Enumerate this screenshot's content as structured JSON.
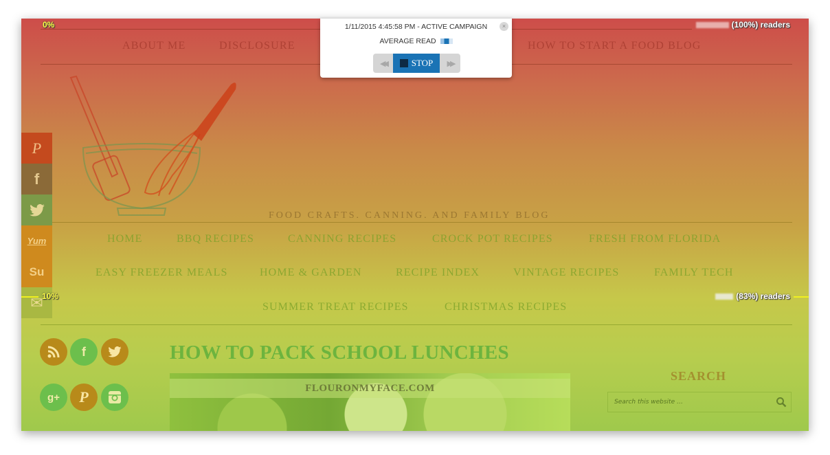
{
  "heatmap": {
    "top_marker": "0%",
    "top_readers": "(100%) readers",
    "mid_marker": "10%",
    "mid_readers": "(83%) readers"
  },
  "popup": {
    "title": "1/11/2015 4:45:58 PM - ACTIVE CAMPAIGN",
    "average_read_label": "AVERAGE READ",
    "stop_label": "STOP",
    "close_glyph": "×",
    "rewind_glyph": "◀◀",
    "forward_glyph": "▶▶"
  },
  "top_nav": [
    "ABOUT ME",
    "DISCLOSURE",
    "HOW TO START A FOOD BLOG"
  ],
  "tagline": "FOOD CRAFTS, CANNING, AND FAMILY BLOG",
  "share_bar": [
    {
      "icon": "pinterest-icon",
      "glyph": "P",
      "color": "#c44a1e"
    },
    {
      "icon": "facebook-icon",
      "glyph": "f",
      "color": "#8b6a38"
    },
    {
      "icon": "twitter-icon",
      "glyph": "t",
      "color": "#7c9a48"
    },
    {
      "icon": "yummly-icon",
      "glyph": "Yum",
      "color": "#cf8a1e"
    },
    {
      "icon": "stumbleupon-icon",
      "glyph": "Su",
      "color": "#cf8a1e"
    },
    {
      "icon": "email-icon",
      "glyph": "✉",
      "color": "#a9b842"
    }
  ],
  "main_nav": {
    "row1": [
      "HOME",
      "BBQ RECIPES",
      "CANNING RECIPES",
      "CROCK POT RECIPES",
      "FRESH FROM FLORIDA"
    ],
    "row2": [
      "EASY FREEZER MEALS",
      "HOME & GARDEN",
      "RECIPE INDEX",
      "VINTAGE RECIPES",
      "FAMILY TECH"
    ],
    "row3": [
      "SUMMER TREAT RECIPES",
      "CHRISTMAS RECIPES"
    ]
  },
  "social_circles": [
    {
      "icon": "rss-icon",
      "glyph": "))",
      "color": "#b88a1a"
    },
    {
      "icon": "facebook-icon",
      "glyph": "f",
      "color": "#6cbf4c"
    },
    {
      "icon": "twitter-icon",
      "glyph": "t",
      "color": "#b88a1a"
    },
    {
      "icon": "google-plus-icon",
      "glyph": "g+",
      "color": "#6cbf4c"
    },
    {
      "icon": "pinterest-icon",
      "glyph": "P",
      "color": "#b88a1a"
    },
    {
      "icon": "instagram-icon",
      "glyph": "◙",
      "color": "#6cbf4c"
    }
  ],
  "post": {
    "title": "HOW TO PACK SCHOOL LUNCHES",
    "image_watermark": "FLOURONMYFACE.COM"
  },
  "sidebar": {
    "search_title": "SEARCH",
    "search_placeholder": "Search this website …"
  }
}
